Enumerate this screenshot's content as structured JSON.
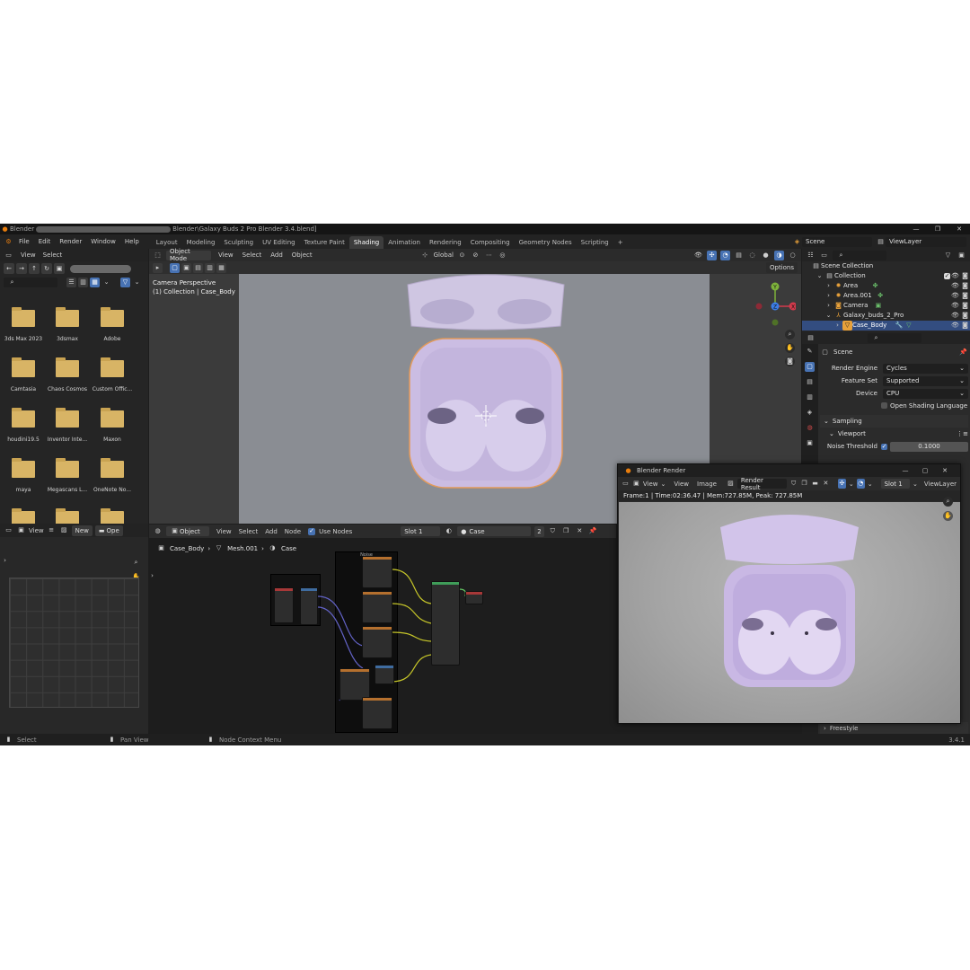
{
  "titlebar": {
    "app": "Blender",
    "path": "Blender\\Galaxy Buds 2 Pro Blender 3.4.blend]",
    "controls": [
      "—",
      "❐",
      "✕"
    ]
  },
  "menubar": {
    "menus": [
      "File",
      "Edit",
      "Render",
      "Window",
      "Help"
    ],
    "workspaces": [
      "Layout",
      "Modeling",
      "Sculpting",
      "UV Editing",
      "Texture Paint",
      "Shading",
      "Animation",
      "Rendering",
      "Compositing",
      "Geometry Nodes",
      "Scripting"
    ],
    "active_workspace": "Shading",
    "add_tab": "+",
    "scene": "Scene",
    "view_layer": "ViewLayer"
  },
  "file_browser": {
    "menus": [
      "View",
      "Select"
    ],
    "folders": [
      "3ds Max 2023",
      "3dsmax",
      "Adobe",
      "Camtasia",
      "Chaos Cosmos",
      "Custom Offic...",
      "houdini19.5",
      "Inventor Inte...",
      "Maxon",
      "maya",
      "Megascans L...",
      "OneNote No..."
    ]
  },
  "image_editor": {
    "view": "View",
    "new": "New",
    "open": "Ope"
  },
  "viewport": {
    "mode": "Object Mode",
    "menus": [
      "View",
      "Select",
      "Add",
      "Object"
    ],
    "orientation": "Global",
    "options": "Options",
    "overlay_line1": "Camera Perspective",
    "overlay_line2": "(1) Collection | Case_Body",
    "gizmo": {
      "x": "X",
      "y": "Y",
      "z": "Z"
    }
  },
  "node_editor": {
    "type": "Object",
    "menus": [
      "View",
      "Select",
      "Add",
      "Node"
    ],
    "use_nodes": "Use Nodes",
    "slot": "Slot 1",
    "material": "Case",
    "users": "2",
    "breadcrumb": [
      "Case_Body",
      "Mesh.001",
      "Case"
    ],
    "frame_label": "Noise"
  },
  "outliner": {
    "root": "Scene Collection",
    "items": [
      {
        "label": "Collection"
      },
      {
        "label": "Area"
      },
      {
        "label": "Area.001"
      },
      {
        "label": "Camera"
      },
      {
        "label": "Galaxy_buds_2_Pro"
      },
      {
        "label": "Case_Body"
      }
    ]
  },
  "properties": {
    "scene": "Scene",
    "render_engine_label": "Render Engine",
    "render_engine": "Cycles",
    "feature_set_label": "Feature Set",
    "feature_set": "Supported",
    "device_label": "Device",
    "device": "CPU",
    "osl": "Open Shading Language",
    "sampling": "Sampling",
    "viewport_panel": "Viewport",
    "noise_threshold_label": "Noise Threshold",
    "noise_threshold": "0.1000",
    "freestyle": "Freestyle"
  },
  "render_window": {
    "title": "Blender Render",
    "menus": [
      "View",
      "View",
      "Image"
    ],
    "result": "Render Result",
    "slot": "Slot 1",
    "view_layer": "ViewLayer",
    "stats": "Frame:1 | Time:02:36.47 | Mem:727.85M, Peak: 727.85M"
  },
  "statusbar": {
    "select": "Select",
    "pan": "Pan View",
    "context": "Node Context Menu",
    "version": "3.4.1"
  },
  "colors": {
    "accent": "#4772b3",
    "lilac": "#cbbde3",
    "folder": "#d8b465"
  }
}
